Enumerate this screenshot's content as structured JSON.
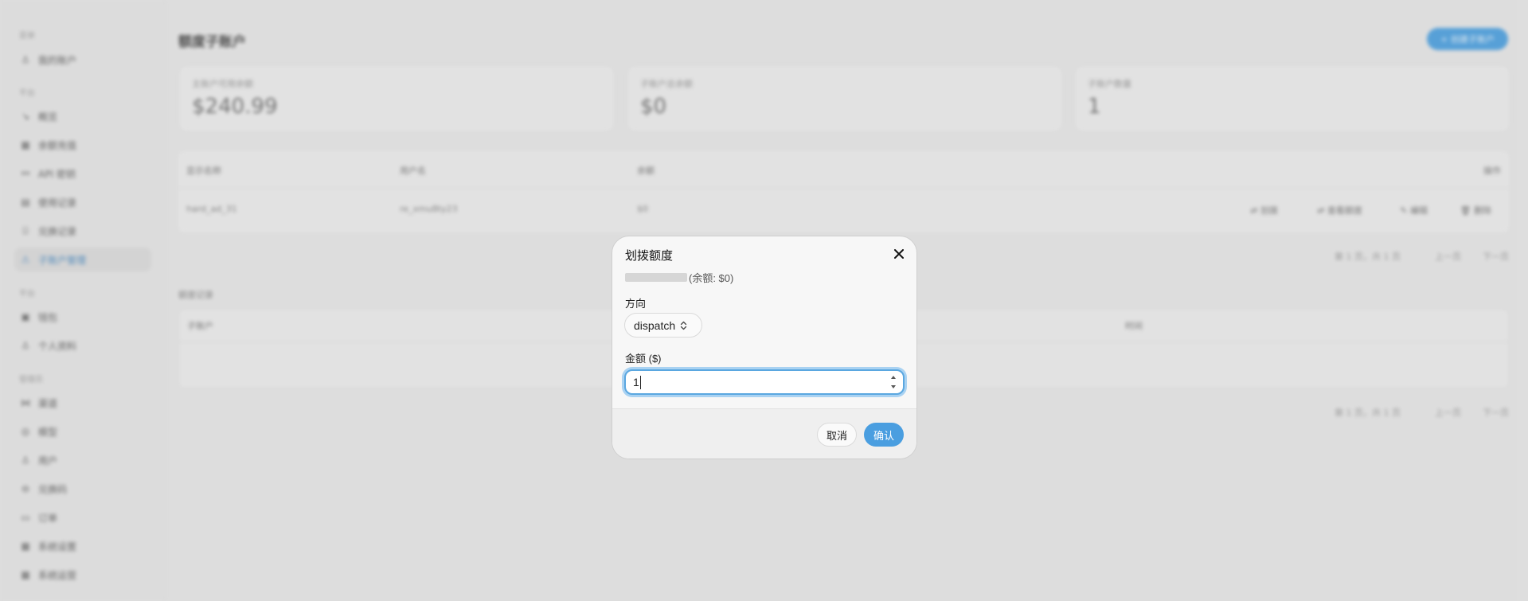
{
  "background": {
    "sidebar": {
      "groups": [
        "菜单",
        "平台",
        "平台",
        "管理员"
      ],
      "items": [
        {
          "label": "我的账户",
          "icon": "user-icon"
        },
        {
          "label": "概览",
          "icon": "chart-icon"
        },
        {
          "label": "余额充值",
          "icon": "wallet-icon"
        },
        {
          "label": "API 密钥",
          "icon": "link-icon"
        },
        {
          "label": "使用记录",
          "icon": "list-icon"
        },
        {
          "label": "兑换记录",
          "icon": "gift-icon"
        },
        {
          "label": "子账户管理",
          "icon": "users-icon"
        },
        {
          "label": "钱包",
          "icon": "clipboard-icon"
        },
        {
          "label": "个人资料",
          "icon": "user-icon"
        },
        {
          "label": "渠道",
          "icon": "route-icon"
        },
        {
          "label": "模型",
          "icon": "cube-icon"
        },
        {
          "label": "用户",
          "icon": "user-icon"
        },
        {
          "label": "兑换码",
          "icon": "ticket-icon"
        },
        {
          "label": "订单",
          "icon": "order-icon"
        },
        {
          "label": "系统设置",
          "icon": "settings-icon"
        },
        {
          "label": "系统运营",
          "icon": "ops-icon"
        }
      ]
    },
    "page_title": "额度子账户",
    "create_button": "+ 创建子账户",
    "stats": [
      {
        "label": "主账户可用余额",
        "value": "$240.99"
      },
      {
        "label": "子账户总余额",
        "value": "$0"
      },
      {
        "label": "子账户数量",
        "value": "1"
      }
    ],
    "table": {
      "headers": [
        "显示名称",
        "用户名",
        "余额",
        "操作"
      ],
      "rows": [
        {
          "display_name": "hard_ad_31",
          "username": "re_xmu8ty23",
          "balance": "$0"
        }
      ],
      "actions": [
        "划拨",
        "查看额度",
        "编辑",
        "删除"
      ]
    },
    "pager_text": "第 1 页，共 1 页",
    "pager_prev": "上一页",
    "pager_next": "下一页",
    "section2_title": "额度记录",
    "table2_headers": [
      "子账户",
      "",
      "",
      "时间"
    ]
  },
  "modal": {
    "title": "划拨额度",
    "balance_note": "(余额: $0)",
    "direction_label": "方向",
    "direction_value": "dispatch",
    "amount_label": "金额 ($)",
    "amount_value": "1",
    "cancel_label": "取消",
    "confirm_label": "确认"
  },
  "colors": {
    "accent": "#4a9ee0",
    "focus_ring": "#a9d2f2"
  }
}
